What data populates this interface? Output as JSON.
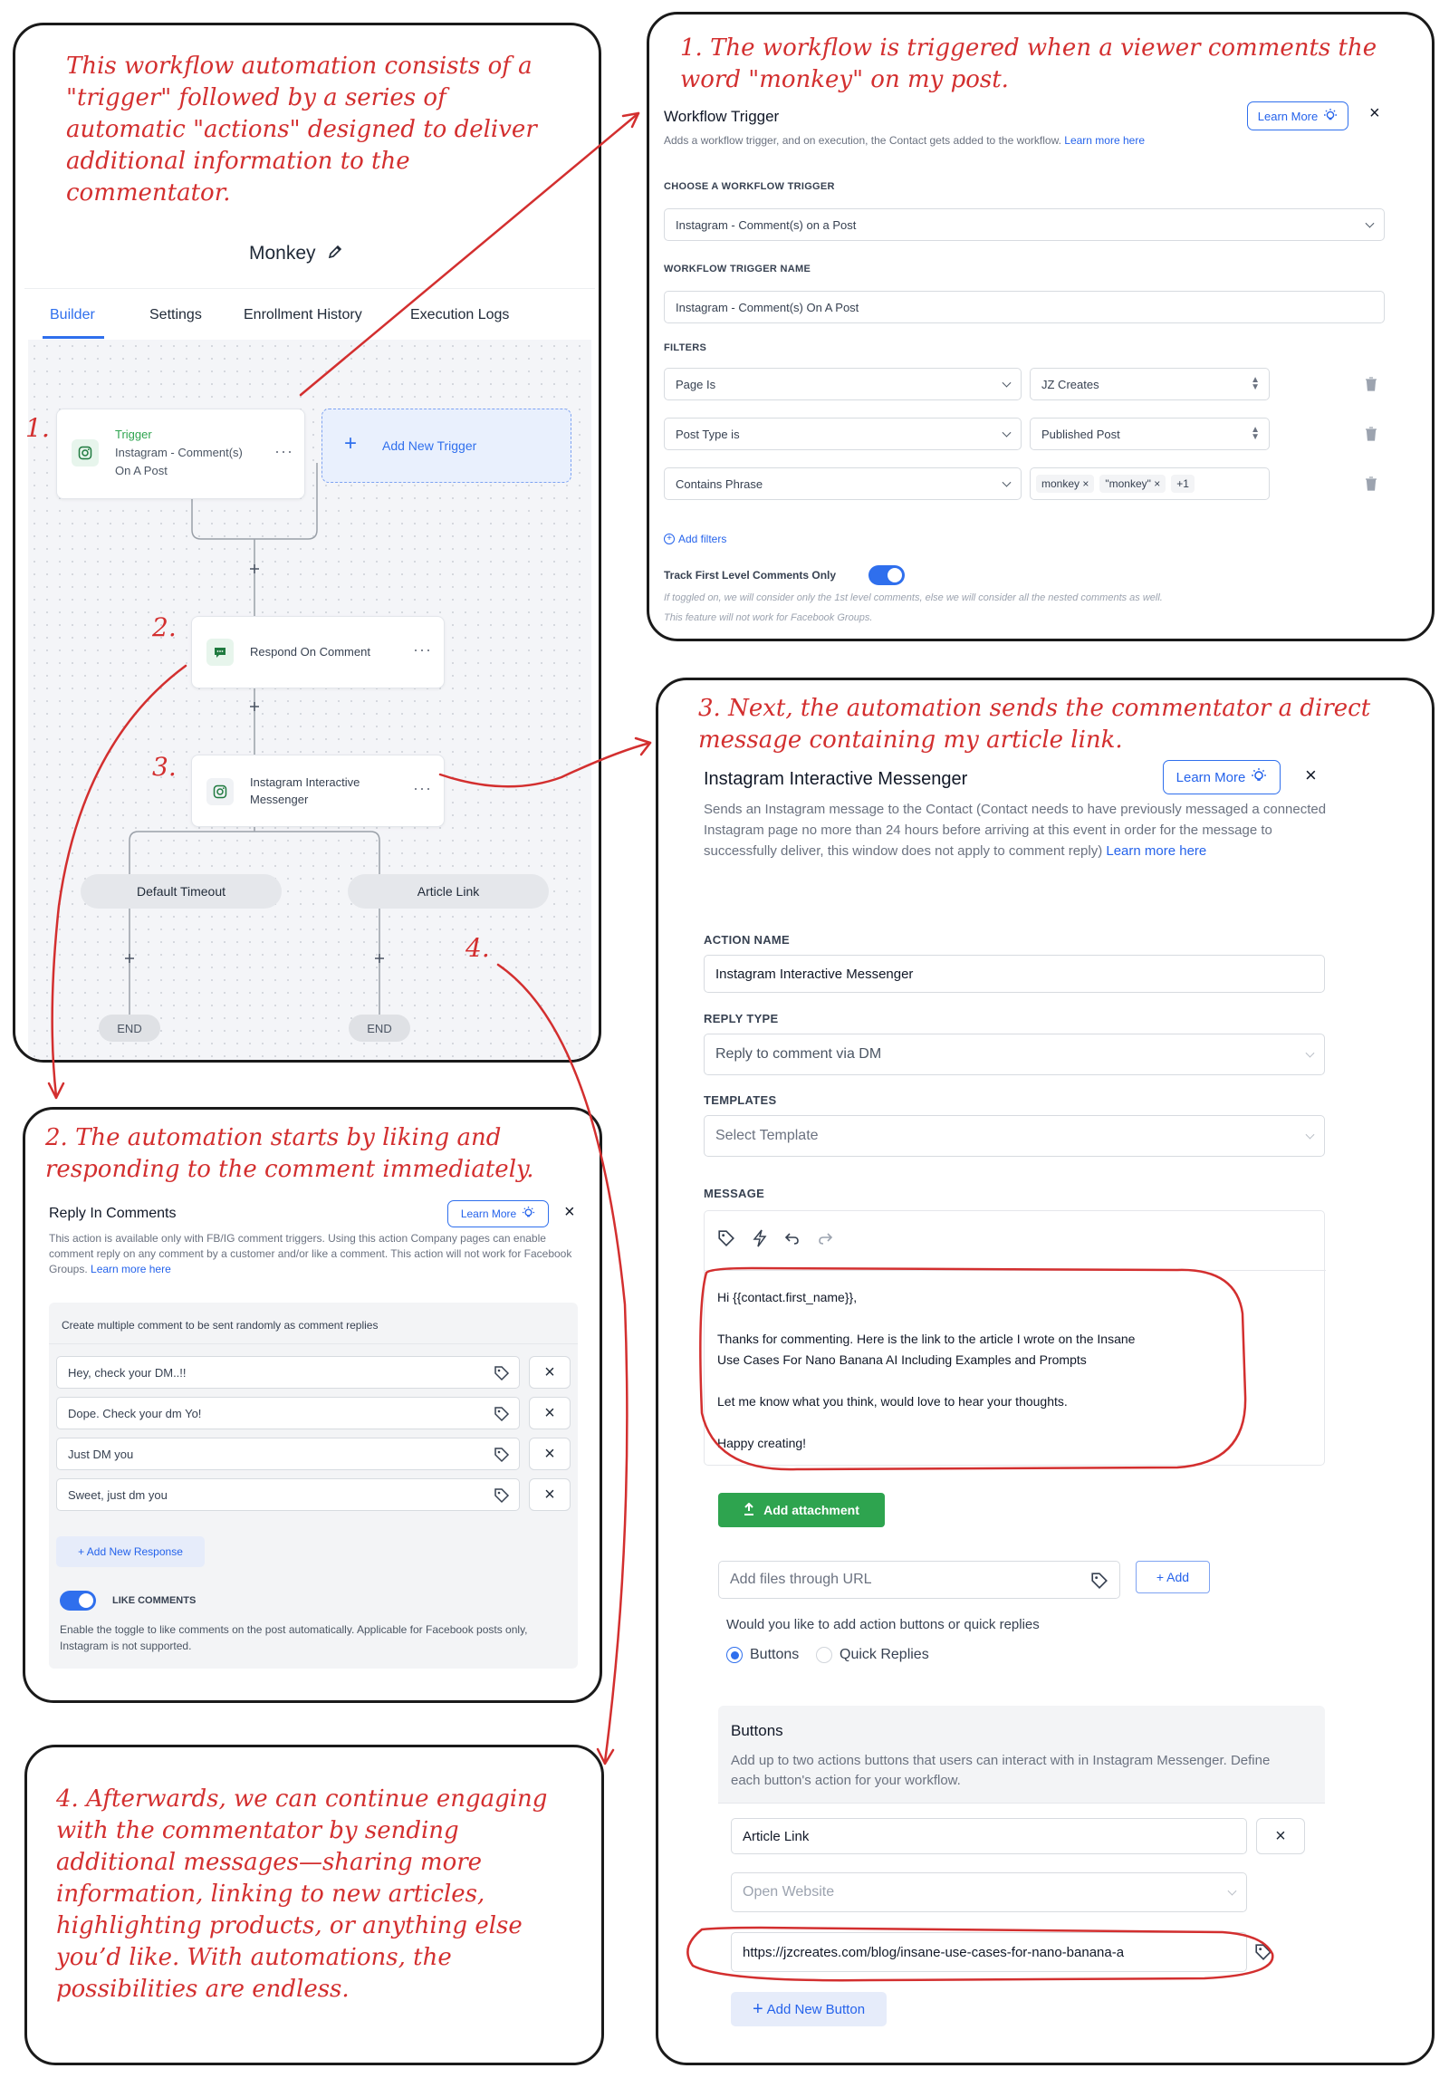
{
  "notes": {
    "intro": "This workflow automation consists of a \"trigger\" followed by a series of automatic \"actions\" designed to deliver additional information to the commentator.",
    "step1": "1. The workflow is triggered when a viewer comments the word \"monkey\" on my post.",
    "step2": "2. The automation starts by liking and responding to the comment immediately.",
    "step3": "3. Next, the automation sends the commentator a direct message containing my article link.",
    "step4": "4. Afterwards, we can continue engaging with the commentator by sending additional messages—sharing more information, linking to new articles, highlighting products, or anything else you’d like. With automations, the possibilities are endless.",
    "marker1": "1.",
    "marker2": "2.",
    "marker3": "3.",
    "marker4": "4."
  },
  "builder": {
    "title": "Monkey",
    "tabs": [
      "Builder",
      "Settings",
      "Enrollment History",
      "Execution Logs"
    ],
    "trigger_card": {
      "label": "Trigger",
      "line1": "Instagram - Comment(s)",
      "line2": "On A Post"
    },
    "add_trigger": "Add New Trigger",
    "respond_node": "Respond On Comment",
    "messenger_node": {
      "line1": "Instagram Interactive",
      "line2": "Messenger"
    },
    "branch_left": "Default Timeout",
    "branch_right": "Article Link",
    "end_left": "END",
    "end_right": "END"
  },
  "trigger_panel": {
    "title": "Workflow Trigger",
    "learn_more": "Learn More",
    "desc": "Adds a workflow trigger, and on execution, the Contact gets added to the workflow.",
    "desc_link": "Learn more here",
    "choose_label": "CHOOSE A WORKFLOW TRIGGER",
    "choose_value": "Instagram - Comment(s) on a Post",
    "name_label": "WORKFLOW TRIGGER NAME",
    "name_value": "Instagram - Comment(s) On A Post",
    "filters_label": "FILTERS",
    "filters": [
      {
        "field": "Page Is",
        "value": "JZ Creates"
      },
      {
        "field": "Post Type is",
        "value": "Published Post"
      },
      {
        "field": "Contains Phrase",
        "value": ""
      }
    ],
    "tags": [
      "monkey",
      "\"monkey\""
    ],
    "tags_more": "+1",
    "add_filters": "Add filters",
    "track_label": "Track First Level Comments Only",
    "track_note1": "If toggled on, we will consider only the 1st level comments, else we will consider all the nested comments as well.",
    "track_note2": "This feature will not work for Facebook Groups."
  },
  "reply_panel": {
    "title": "Reply In Comments",
    "learn_more": "Learn More",
    "desc": "This action is available only with FB/IG comment triggers. Using this action Company pages can enable comment reply on any comment by a customer and/or like a comment. This action will not work for Facebook Groups.",
    "desc_link": "Learn more here",
    "box_header": "Create multiple comment to be sent randomly as comment replies",
    "responses": [
      "Hey, check your DM..!!",
      "Dope. Check your dm Yo!",
      "Just DM you",
      "Sweet, just dm you"
    ],
    "add_response": "+ Add New Response",
    "like_label": "LIKE COMMENTS",
    "like_note": "Enable the toggle to like comments on the post automatically. Applicable for Facebook posts only, Instagram is not supported."
  },
  "messenger_panel": {
    "title": "Instagram Interactive Messenger",
    "learn_more": "Learn More",
    "desc": "Sends an Instagram message to the Contact (Contact needs to have previously messaged a connected Instagram page no more than 24 hours before arriving at this event in order for the message to successfully deliver, this window does not apply to comment reply)",
    "desc_link": "Learn more here",
    "action_name_label": "ACTION NAME",
    "action_name_value": "Instagram Interactive Messenger",
    "reply_type_label": "REPLY TYPE",
    "reply_type_value": "Reply to comment via DM",
    "templates_label": "TEMPLATES",
    "templates_placeholder": "Select Template",
    "message_label": "MESSAGE",
    "message_lines": [
      "Hi {{contact.first_name}},",
      "Thanks for commenting. Here is the link to the article I wrote on the Insane",
      "Use Cases For Nano Banana AI Including Examples and Prompts",
      "Let me know what you think, would love to hear your thoughts.",
      "Happy creating!"
    ],
    "add_attachment": "Add attachment",
    "url_placeholder": "Add files through URL",
    "url_add": "+ Add",
    "buttons_question": "Would you like to add action buttons or quick replies",
    "radio_buttons": "Buttons",
    "radio_quick": "Quick Replies",
    "buttons_title": "Buttons",
    "buttons_desc": "Add up to two actions buttons that users can interact with in Instagram Messenger. Define each button's action for your workflow.",
    "button_name": "Article Link",
    "button_action": "Open Website",
    "button_url": "https://jzcreates.com/blog/insane-use-cases-for-nano-banana-a",
    "add_button": "Add New Button"
  },
  "colors": {
    "annotation": "#d32f2f",
    "accent": "#2f6fed",
    "green": "#2ea44f"
  }
}
